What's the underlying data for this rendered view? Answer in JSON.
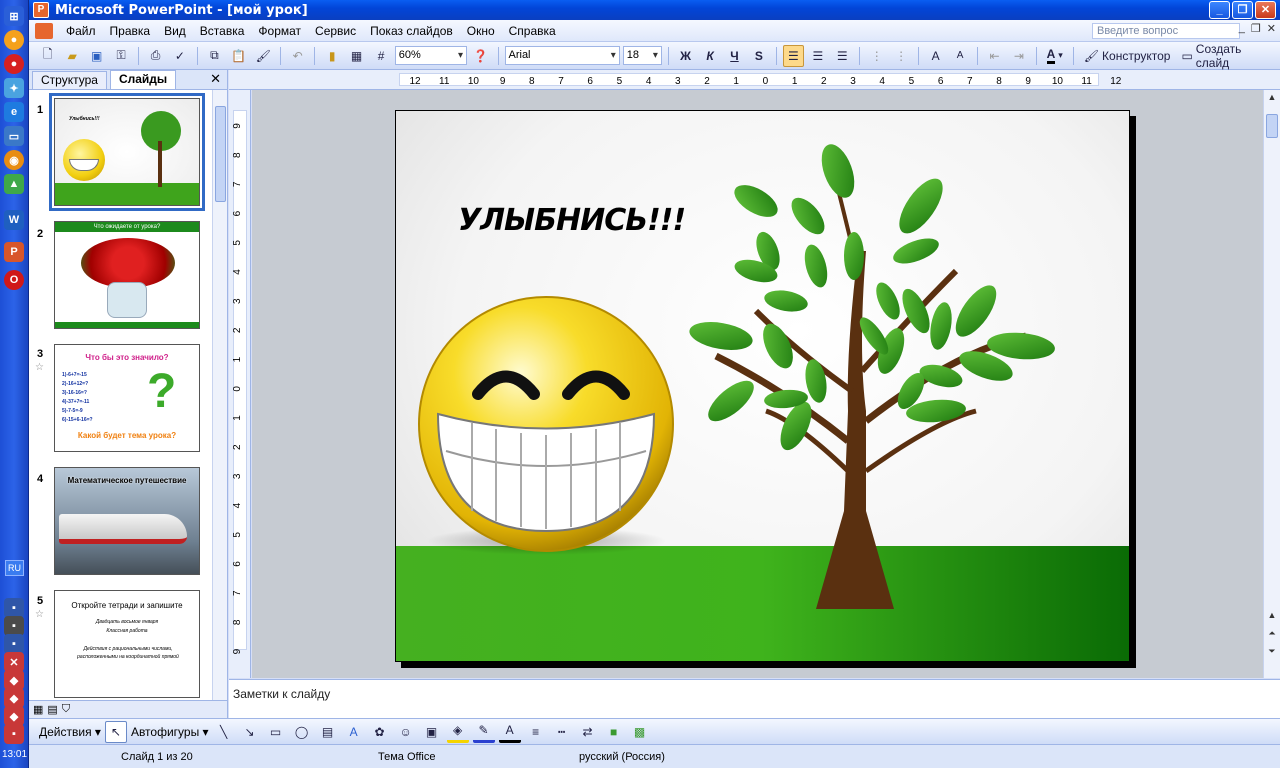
{
  "window": {
    "title": "Microsoft PowerPoint - [мой урок]"
  },
  "menu": {
    "items": [
      "Файл",
      "Правка",
      "Вид",
      "Вставка",
      "Формат",
      "Сервис",
      "Показ слайдов",
      "Окно",
      "Справка"
    ],
    "help_placeholder": "Введите вопрос"
  },
  "toolbar": {
    "zoom": "60%",
    "font": "Arial",
    "font_size": "18",
    "bold": "Ж",
    "italic": "К",
    "underline": "Ч",
    "shadow": "S",
    "designer": "Конструктор",
    "new_slide": "Создать слайд"
  },
  "left_pane": {
    "tabs": [
      "Структура",
      "Слайды"
    ],
    "thumbs": [
      {
        "num": "1",
        "caption": "Улыбнись!!!"
      },
      {
        "num": "2",
        "caption": "Что ожидаете от урока?"
      },
      {
        "num": "3",
        "caption": "Что бы это значило?",
        "footer": "Какой будет тема урока?",
        "lines": [
          "1)-6+7=-15",
          "2)-16+12=?",
          "3)-16-16=?",
          "4)-37+7=-11",
          "5)-7-5=-9",
          "6)-15+6-16=?"
        ]
      },
      {
        "num": "4",
        "caption": "Математическое путешествие"
      },
      {
        "num": "5",
        "caption": "Откройте тетради и запишите",
        "bullets": [
          "Двадцать восьмое января",
          "Классная работа",
          "Действия с рациональными числами, расположенными на координатной прямой"
        ]
      }
    ]
  },
  "slide": {
    "title": "УЛЫБНИСЬ!!!"
  },
  "notes": {
    "placeholder": "Заметки к слайду"
  },
  "drawbar": {
    "actions": "Действия",
    "autoshapes": "Автофигуры"
  },
  "status": {
    "slide": "Слайд 1 из 20",
    "theme": "Тема Office",
    "language": "русский (Россия)"
  },
  "taskbar": {
    "clock": "13:01",
    "lang": "RU"
  },
  "ruler": {
    "h_ticks": [
      "12",
      "11",
      "10",
      "9",
      "8",
      "7",
      "6",
      "5",
      "4",
      "3",
      "2",
      "1",
      "0",
      "1",
      "2",
      "3",
      "4",
      "5",
      "6",
      "7",
      "8",
      "9",
      "10",
      "11",
      "12"
    ],
    "v_ticks": [
      "9",
      "8",
      "7",
      "6",
      "5",
      "4",
      "3",
      "2",
      "1",
      "0",
      "1",
      "2",
      "3",
      "4",
      "5",
      "6",
      "7",
      "8",
      "9"
    ]
  },
  "colors": {
    "accent": "#316ac5",
    "ground": "#3fb31c",
    "leaf": "#2e9a1c",
    "trunk": "#5a3010",
    "smiley": "#f6d21a"
  }
}
